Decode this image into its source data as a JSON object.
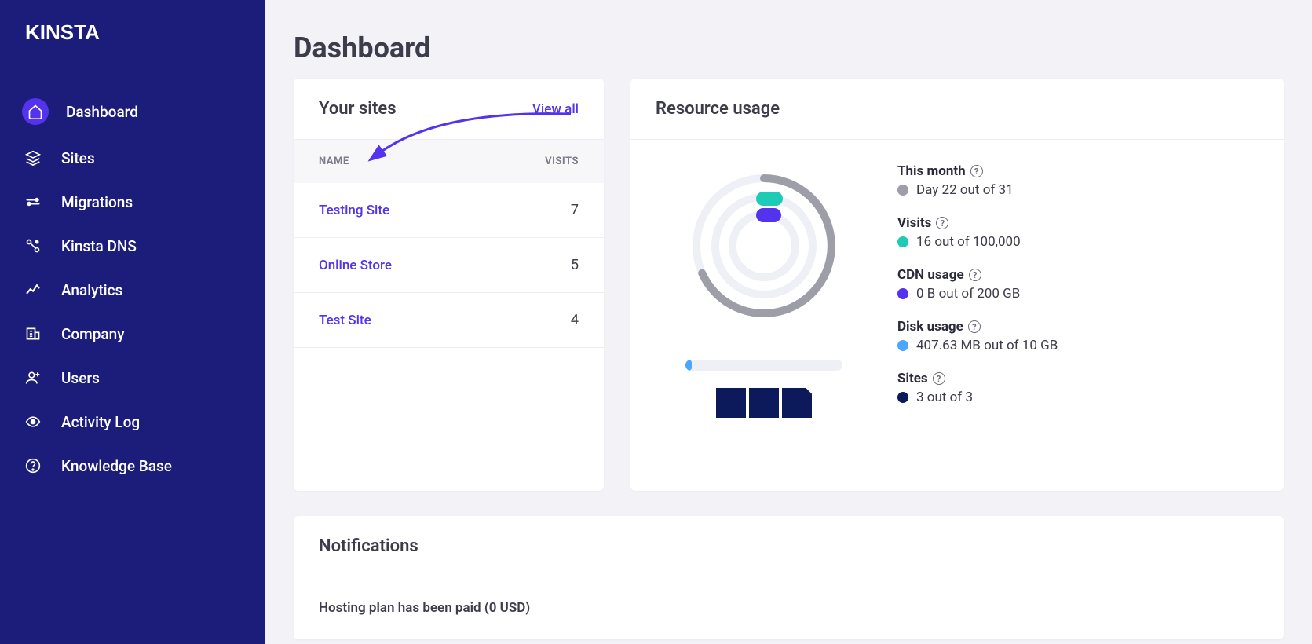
{
  "brand": "kinsta",
  "page_title": "Dashboard",
  "sidebar": {
    "items": [
      {
        "label": "Dashboard",
        "icon": "home-icon",
        "active": true
      },
      {
        "label": "Sites",
        "icon": "layers-icon"
      },
      {
        "label": "Migrations",
        "icon": "migrations-icon"
      },
      {
        "label": "Kinsta DNS",
        "icon": "dns-icon"
      },
      {
        "label": "Analytics",
        "icon": "analytics-icon"
      },
      {
        "label": "Company",
        "icon": "company-icon"
      },
      {
        "label": "Users",
        "icon": "users-icon"
      },
      {
        "label": "Activity Log",
        "icon": "eye-icon"
      },
      {
        "label": "Knowledge Base",
        "icon": "help-icon"
      }
    ]
  },
  "your_sites": {
    "title": "Your sites",
    "view_all": "View all",
    "col_name": "NAME",
    "col_visits": "VISITS",
    "rows": [
      {
        "name": "Testing Site",
        "visits": "7"
      },
      {
        "name": "Online Store",
        "visits": "5"
      },
      {
        "name": "Test Site",
        "visits": "4"
      }
    ]
  },
  "resource": {
    "title": "Resource usage",
    "this_month_label": "This month",
    "this_month_value": "Day 22 out of 31",
    "visits_label": "Visits",
    "visits_value": "16 out of 100,000",
    "cdn_label": "CDN usage",
    "cdn_value": "0 B out of 200 GB",
    "disk_label": "Disk usage",
    "disk_value": "407.63 MB out of 10 GB",
    "sites_label": "Sites",
    "sites_value": "3 out of 3",
    "colors": {
      "month": "#9e9ea8",
      "visits": "#1ecbb6",
      "cdn": "#5333ed",
      "disk": "#4aa6ff",
      "sites": "#0c1a5c"
    }
  },
  "notifications": {
    "title": "Notifications",
    "item0": "Hosting plan has been paid (0 USD)"
  },
  "chart_data": {
    "type": "pie",
    "title": "Resource usage",
    "series": [
      {
        "name": "This month",
        "value": 22,
        "max": 31,
        "unit": "days",
        "color": "#9e9ea8"
      },
      {
        "name": "Visits",
        "value": 16,
        "max": 100000,
        "unit": "visits",
        "color": "#1ecbb6"
      },
      {
        "name": "CDN usage",
        "value": 0,
        "max": 200,
        "unit": "GB",
        "color": "#5333ed"
      },
      {
        "name": "Disk usage",
        "value": 407.63,
        "max": 10240,
        "unit": "MB",
        "color": "#4aa6ff"
      },
      {
        "name": "Sites",
        "value": 3,
        "max": 3,
        "unit": "sites",
        "color": "#0c1a5c"
      }
    ]
  }
}
